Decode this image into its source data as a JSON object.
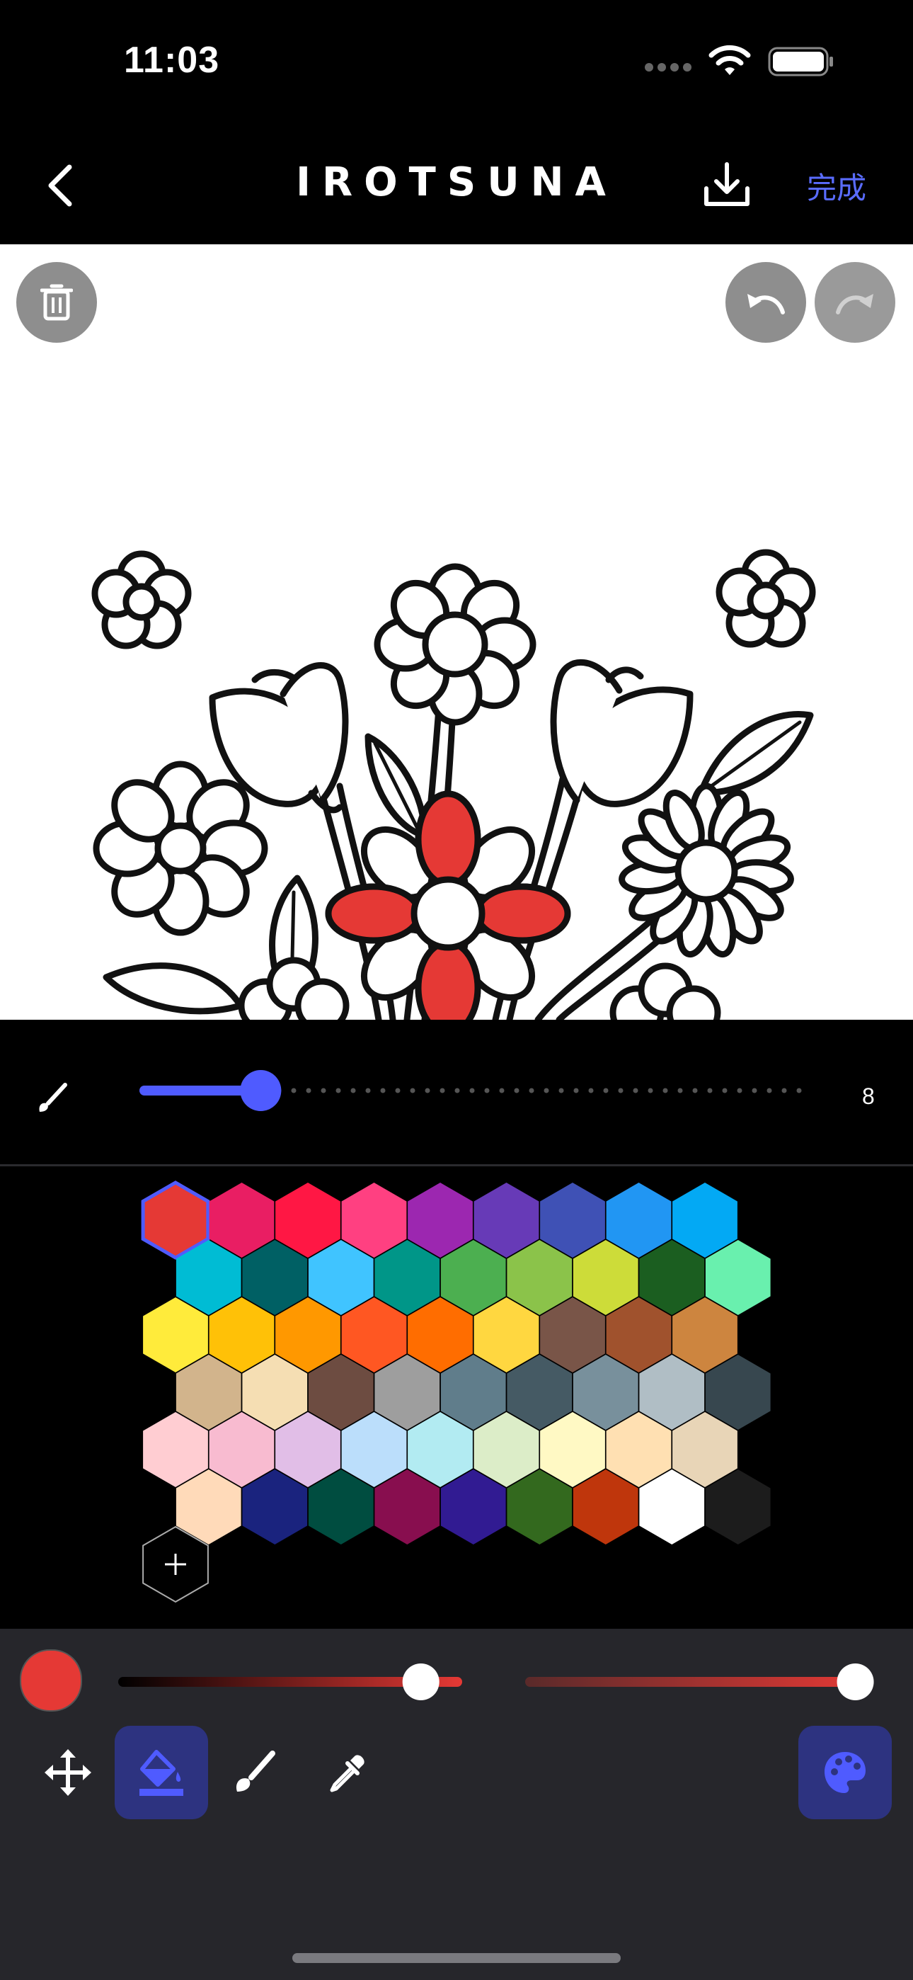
{
  "status_bar": {
    "time": "11:03"
  },
  "nav": {
    "title": "IROTSUNA",
    "done_label": "完成"
  },
  "brush": {
    "size_value": "8",
    "size_fraction": 0.18
  },
  "palette": {
    "rows": [
      [
        "#e53935",
        "#e91e63",
        "#ff1744",
        "#ff4081",
        "#9c27b0",
        "#673ab7",
        "#3f51b5",
        "#2196f3",
        "#03a9f4"
      ],
      [
        "#00bcd4",
        "#006064",
        "#40c4ff",
        "#009688",
        "#4caf50",
        "#8bc34a",
        "#cddc39",
        "#1b5e20",
        "#69f0ae"
      ],
      [
        "#ffeb3b",
        "#ffc107",
        "#ff9800",
        "#ff5722",
        "#ff6d00",
        "#ffd740",
        "#795548",
        "#a0522d",
        "#cd853f"
      ],
      [
        "#d2b48c",
        "#f5deb3",
        "#6d4c41",
        "#9e9e9e",
        "#607d8b",
        "#455a64",
        "#78909c",
        "#b0bec5",
        "#37474f"
      ],
      [
        "#ffcdd2",
        "#f8bbd0",
        "#e1bee7",
        "#bbdefb",
        "#b2ebf2",
        "#dcedc8",
        "#fff9c4",
        "#ffe0b2",
        "#e8d5b7"
      ],
      [
        "#ffdab9",
        "#1a237e",
        "#004d40",
        "#880e4f",
        "#311b92",
        "#33691e",
        "#bf360c",
        "#ffffff",
        "#1c1c1c"
      ]
    ],
    "selected": "#e53935"
  },
  "current_color": {
    "hex": "#e53935",
    "brightness_fraction": 0.88,
    "opacity_fraction": 0.96
  },
  "tools": {
    "active": "fill"
  }
}
